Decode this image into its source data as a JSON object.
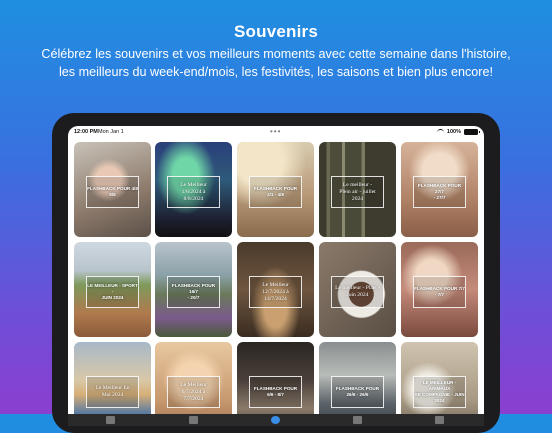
{
  "headline": "Souvenirs",
  "subheadline": "Célébrez les souvenirs et vos meilleurs moments avec cette semaine dans l'histoire, les meilleurs du week-end/mois, les festivités, les saisons et bien plus encore!",
  "status_bar": {
    "time": "12:00 PM",
    "date": "Mon Jan 1",
    "dots": "•••",
    "battery_text": "100%"
  },
  "tiles": [
    {
      "label": "FLASHBACK POUR 4/8\n8/8",
      "style": "sans"
    },
    {
      "label": "Le Meilleur\n1/8/2024 à\n8/8/2024",
      "style": "serif"
    },
    {
      "label": "FLASHBACK POUR\n2/1 - 4/8",
      "style": "sans"
    },
    {
      "label": "Le meilleur -\nPlein air - juillet\n2024",
      "style": "serif"
    },
    {
      "label": "FLASHBACK POUR 27/7\n- 27/7",
      "style": "sans"
    },
    {
      "label": "LE MEILLEUR - SPORT -\nJUIN 2024",
      "style": "sans"
    },
    {
      "label": "FLASHBACK POUR 16/7\n- 20/7",
      "style": "sans"
    },
    {
      "label": "Le Meilleur\n12/7/2024 à\n14/7/2024",
      "style": "serif"
    },
    {
      "label": "Le meilleur - Plats -\nJuin 2024",
      "style": "serif"
    },
    {
      "label": "FLASHBACK POUR 7/7\n- 7/7",
      "style": "sans"
    },
    {
      "label": "Le Meilleur En\nMai 2024",
      "style": "serif"
    },
    {
      "label": "Le Meilleur\n6/7/2024 à\n7/7/2024",
      "style": "serif"
    },
    {
      "label": "FLASHBACK POUR\n6/6 - 8/7",
      "style": "sans"
    },
    {
      "label": "FLASHBACK POUR\n26/6 - 26/6",
      "style": "sans"
    },
    {
      "label": "LE MEILLEUR - ANIMAUX\nDE COMPAGNIE - JUIN\n2024",
      "style": "sans"
    }
  ]
}
